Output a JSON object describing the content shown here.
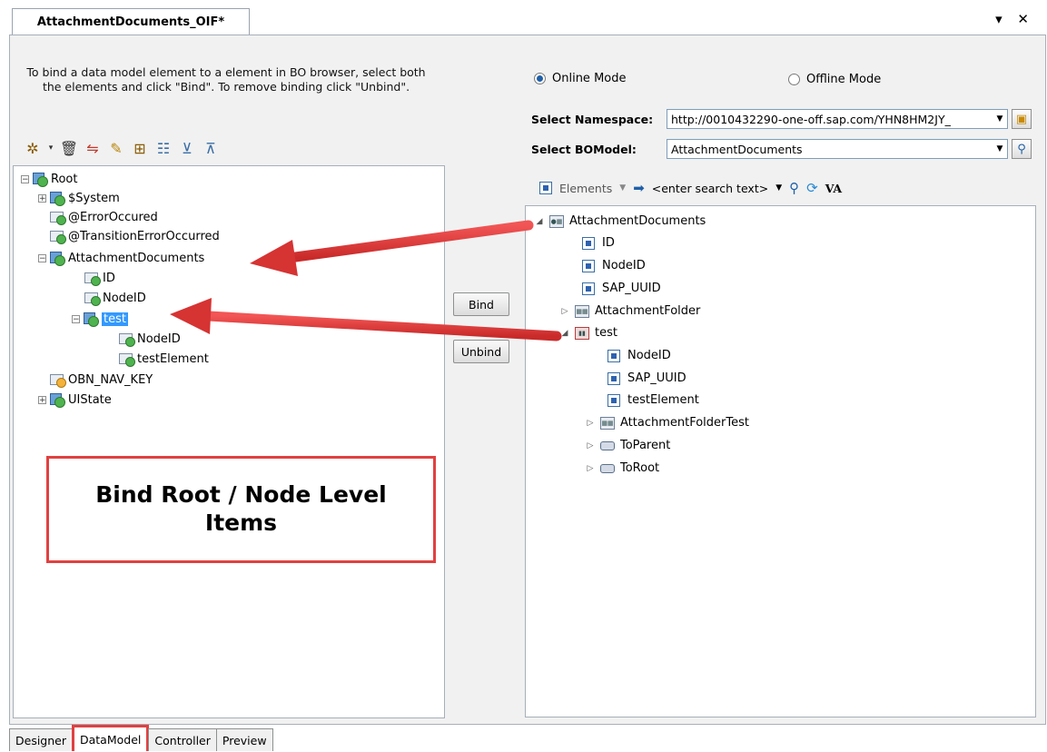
{
  "doc_tab": {
    "title": "AttachmentDocuments_OIF*",
    "controls": "▾ ✕"
  },
  "instructions": "To bind a data model element to a element in BO browser, select both the elements and click \"Bind\". To remove binding click \"Unbind\".",
  "left_toolbar": {
    "icons": [
      "new-icon",
      "delete-icon",
      "bind-icon",
      "edit-icon",
      "structure-icon",
      "hierarchy-icon",
      "expand-all-icon",
      "collapse-all-icon"
    ]
  },
  "data_model_tree": {
    "root": "Root",
    "system": "$System",
    "error_occurred": "@ErrorOccured",
    "transition_error": "@TransitionErrorOccurred",
    "attachment_documents": "AttachmentDocuments",
    "id": "ID",
    "node_id": "NodeID",
    "test": "test",
    "test_node_id": "NodeID",
    "test_element": "testElement",
    "obn_nav_key": "OBN_NAV_KEY",
    "ui_state": "UIState"
  },
  "buttons": {
    "bind": "Bind",
    "unbind": "Unbind"
  },
  "mode": {
    "online": "Online Mode",
    "offline": "Offline Mode",
    "selected": "online"
  },
  "namespace": {
    "label": "Select Namespace:",
    "value": "http://0010432290-one-off.sap.com/YHN8HM2JY_"
  },
  "bomodel": {
    "label": "Select BOModel:",
    "value": "AttachmentDocuments"
  },
  "right_toolbar": {
    "elements_label": "Elements",
    "search_placeholder": "<enter search text>",
    "va_label": "VA"
  },
  "bo_tree": {
    "attachment_documents": "AttachmentDocuments",
    "id": "ID",
    "node_id": "NodeID",
    "sap_uuid": "SAP_UUID",
    "attachment_folder": "AttachmentFolder",
    "test": "test",
    "test_node_id": "NodeID",
    "test_sap_uuid": "SAP_UUID",
    "test_element": "testElement",
    "attachment_folder_test": "AttachmentFolderTest",
    "to_parent": "ToParent",
    "to_root": "ToRoot"
  },
  "callout": {
    "line1": "Bind Root / Node Level",
    "line2": "Items"
  },
  "bottom_tabs": [
    {
      "label": "Designer"
    },
    {
      "label": "DataModel"
    },
    {
      "label": "Controller"
    },
    {
      "label": "Preview"
    }
  ],
  "colors": {
    "accent": "#e14040",
    "selection": "#3399ff"
  }
}
